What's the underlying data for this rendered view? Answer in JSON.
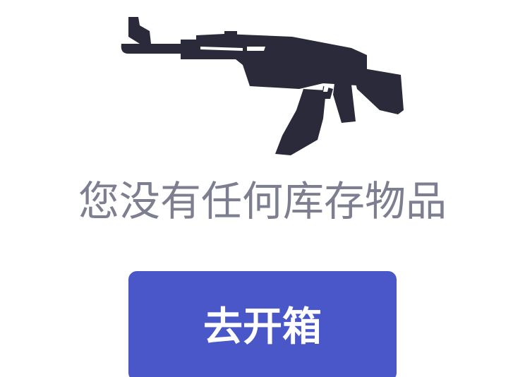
{
  "empty_state": {
    "icon": "rifle-icon",
    "message": "您没有任何库存物品",
    "button_label": "去开箱"
  },
  "colors": {
    "icon": "#2a2a3a",
    "message": "#7d7f91",
    "button_background": "#4957c8",
    "button_text": "#ffffff"
  }
}
